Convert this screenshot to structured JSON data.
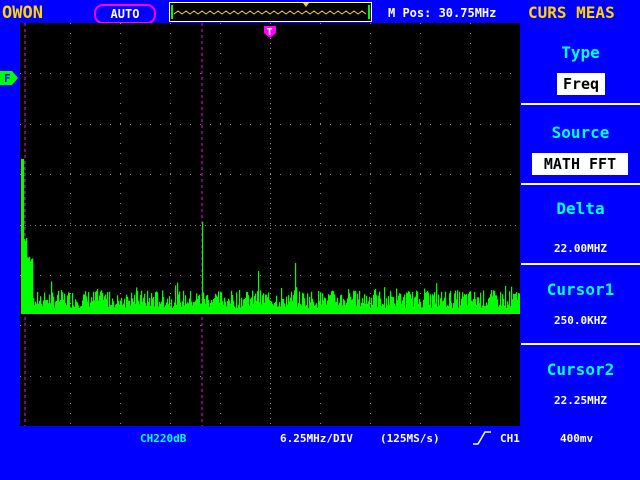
{
  "header": {
    "brand": "OWON",
    "mode": "AUTO",
    "mpos": "M Pos: 30.75MHz",
    "menu_title": "CURS MEAS"
  },
  "markers": {
    "trigger": "T",
    "fft_channel": "F"
  },
  "menu": {
    "items": [
      {
        "label": "Type",
        "value": "Freq"
      },
      {
        "label": "Source",
        "value": "MATH FFT"
      },
      {
        "label": "Delta",
        "value": "22.00MHZ"
      },
      {
        "label": "Cursor1",
        "value": "250.0KHZ"
      },
      {
        "label": "Cursor2",
        "value": "22.25MHZ"
      }
    ]
  },
  "status": {
    "channel_scale": "CH220dB",
    "timebase": "6.25MHz/DIV",
    "sample_rate": "(125MS/s)",
    "trigger_source": "CH1",
    "trigger_level": "400mv"
  },
  "colors": {
    "background": "#0000ff",
    "screen": "#000000",
    "trace": "#00ff00",
    "cursor": "#ff00ff",
    "title": "#ffd400",
    "menu_label": "#00ffff"
  },
  "icons": [
    "trigger-position-icon",
    "fft-channel-icon",
    "rising-edge-icon"
  ]
}
